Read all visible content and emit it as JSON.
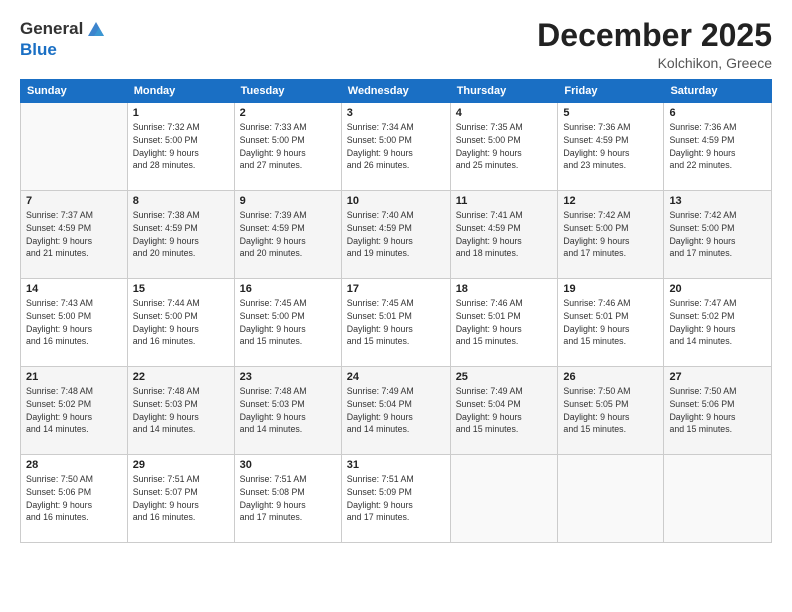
{
  "header": {
    "logo_line1": "General",
    "logo_line2": "Blue",
    "month": "December 2025",
    "location": "Kolchikon, Greece"
  },
  "weekdays": [
    "Sunday",
    "Monday",
    "Tuesday",
    "Wednesday",
    "Thursday",
    "Friday",
    "Saturday"
  ],
  "weeks": [
    [
      {
        "day": "",
        "info": ""
      },
      {
        "day": "1",
        "info": "Sunrise: 7:32 AM\nSunset: 5:00 PM\nDaylight: 9 hours\nand 28 minutes."
      },
      {
        "day": "2",
        "info": "Sunrise: 7:33 AM\nSunset: 5:00 PM\nDaylight: 9 hours\nand 27 minutes."
      },
      {
        "day": "3",
        "info": "Sunrise: 7:34 AM\nSunset: 5:00 PM\nDaylight: 9 hours\nand 26 minutes."
      },
      {
        "day": "4",
        "info": "Sunrise: 7:35 AM\nSunset: 5:00 PM\nDaylight: 9 hours\nand 25 minutes."
      },
      {
        "day": "5",
        "info": "Sunrise: 7:36 AM\nSunset: 4:59 PM\nDaylight: 9 hours\nand 23 minutes."
      },
      {
        "day": "6",
        "info": "Sunrise: 7:36 AM\nSunset: 4:59 PM\nDaylight: 9 hours\nand 22 minutes."
      }
    ],
    [
      {
        "day": "7",
        "info": "Sunrise: 7:37 AM\nSunset: 4:59 PM\nDaylight: 9 hours\nand 21 minutes."
      },
      {
        "day": "8",
        "info": "Sunrise: 7:38 AM\nSunset: 4:59 PM\nDaylight: 9 hours\nand 20 minutes."
      },
      {
        "day": "9",
        "info": "Sunrise: 7:39 AM\nSunset: 4:59 PM\nDaylight: 9 hours\nand 20 minutes."
      },
      {
        "day": "10",
        "info": "Sunrise: 7:40 AM\nSunset: 4:59 PM\nDaylight: 9 hours\nand 19 minutes."
      },
      {
        "day": "11",
        "info": "Sunrise: 7:41 AM\nSunset: 4:59 PM\nDaylight: 9 hours\nand 18 minutes."
      },
      {
        "day": "12",
        "info": "Sunrise: 7:42 AM\nSunset: 5:00 PM\nDaylight: 9 hours\nand 17 minutes."
      },
      {
        "day": "13",
        "info": "Sunrise: 7:42 AM\nSunset: 5:00 PM\nDaylight: 9 hours\nand 17 minutes."
      }
    ],
    [
      {
        "day": "14",
        "info": "Sunrise: 7:43 AM\nSunset: 5:00 PM\nDaylight: 9 hours\nand 16 minutes."
      },
      {
        "day": "15",
        "info": "Sunrise: 7:44 AM\nSunset: 5:00 PM\nDaylight: 9 hours\nand 16 minutes."
      },
      {
        "day": "16",
        "info": "Sunrise: 7:45 AM\nSunset: 5:00 PM\nDaylight: 9 hours\nand 15 minutes."
      },
      {
        "day": "17",
        "info": "Sunrise: 7:45 AM\nSunset: 5:01 PM\nDaylight: 9 hours\nand 15 minutes."
      },
      {
        "day": "18",
        "info": "Sunrise: 7:46 AM\nSunset: 5:01 PM\nDaylight: 9 hours\nand 15 minutes."
      },
      {
        "day": "19",
        "info": "Sunrise: 7:46 AM\nSunset: 5:01 PM\nDaylight: 9 hours\nand 15 minutes."
      },
      {
        "day": "20",
        "info": "Sunrise: 7:47 AM\nSunset: 5:02 PM\nDaylight: 9 hours\nand 14 minutes."
      }
    ],
    [
      {
        "day": "21",
        "info": "Sunrise: 7:48 AM\nSunset: 5:02 PM\nDaylight: 9 hours\nand 14 minutes."
      },
      {
        "day": "22",
        "info": "Sunrise: 7:48 AM\nSunset: 5:03 PM\nDaylight: 9 hours\nand 14 minutes."
      },
      {
        "day": "23",
        "info": "Sunrise: 7:48 AM\nSunset: 5:03 PM\nDaylight: 9 hours\nand 14 minutes."
      },
      {
        "day": "24",
        "info": "Sunrise: 7:49 AM\nSunset: 5:04 PM\nDaylight: 9 hours\nand 14 minutes."
      },
      {
        "day": "25",
        "info": "Sunrise: 7:49 AM\nSunset: 5:04 PM\nDaylight: 9 hours\nand 15 minutes."
      },
      {
        "day": "26",
        "info": "Sunrise: 7:50 AM\nSunset: 5:05 PM\nDaylight: 9 hours\nand 15 minutes."
      },
      {
        "day": "27",
        "info": "Sunrise: 7:50 AM\nSunset: 5:06 PM\nDaylight: 9 hours\nand 15 minutes."
      }
    ],
    [
      {
        "day": "28",
        "info": "Sunrise: 7:50 AM\nSunset: 5:06 PM\nDaylight: 9 hours\nand 16 minutes."
      },
      {
        "day": "29",
        "info": "Sunrise: 7:51 AM\nSunset: 5:07 PM\nDaylight: 9 hours\nand 16 minutes."
      },
      {
        "day": "30",
        "info": "Sunrise: 7:51 AM\nSunset: 5:08 PM\nDaylight: 9 hours\nand 17 minutes."
      },
      {
        "day": "31",
        "info": "Sunrise: 7:51 AM\nSunset: 5:09 PM\nDaylight: 9 hours\nand 17 minutes."
      },
      {
        "day": "",
        "info": ""
      },
      {
        "day": "",
        "info": ""
      },
      {
        "day": "",
        "info": ""
      }
    ]
  ]
}
